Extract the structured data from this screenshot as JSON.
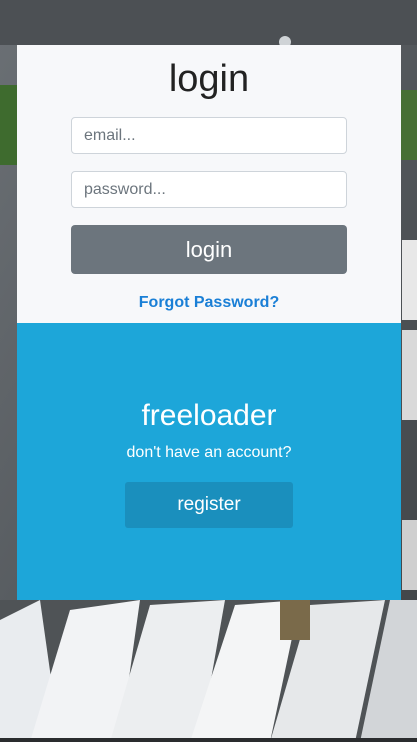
{
  "login": {
    "title": "login",
    "email_placeholder": "email...",
    "email_value": "",
    "password_placeholder": "password...",
    "password_value": "",
    "login_button": "login",
    "forgot_link": "Forgot Password?"
  },
  "signup": {
    "brand": "freeloader",
    "prompt": "don't have an account?",
    "register_button": "register"
  },
  "colors": {
    "top_panel": "#f7f8fa",
    "bottom_panel": "#1da6d9",
    "login_button": "#6c757d",
    "register_button": "#1a8fbd",
    "link": "#1a7fd6"
  },
  "background": {
    "icon": "trucks-aerial-photo"
  }
}
